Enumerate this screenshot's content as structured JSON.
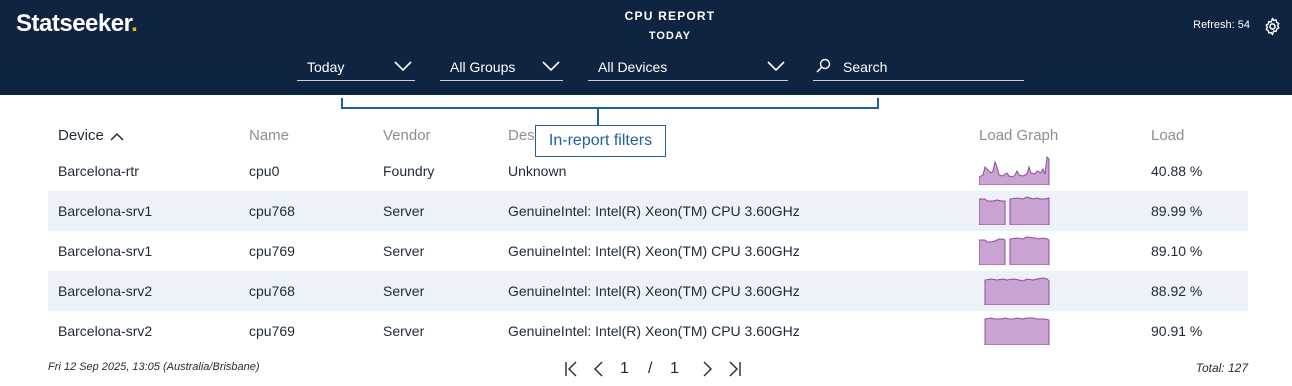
{
  "app": {
    "logo_text": "Statseeker",
    "logo_dot": ".",
    "logo_dot_color": "#f5b400",
    "header_bg": "#0e2441",
    "accent": "#1f5fa8"
  },
  "report": {
    "title": "CPU REPORT",
    "subtitle": "TODAY"
  },
  "refresh": {
    "label": "Refresh: 54"
  },
  "filters": {
    "time": "Today",
    "groups": "All Groups",
    "devices": "All Devices",
    "search_placeholder": "Search"
  },
  "callout": {
    "text": "In-report filters"
  },
  "columns": {
    "device": "Device",
    "name": "Name",
    "vendor": "Vendor",
    "description": "Des",
    "load_graph": "Load Graph",
    "load": "Load"
  },
  "sort": {
    "column": "Device",
    "direction": "ascending",
    "icon": "chevron-up-icon"
  },
  "rows": [
    {
      "device": "Barcelona-rtr",
      "name": "cpu0",
      "vendor": "Foundry",
      "description": "Unknown",
      "load": "40.88 %"
    },
    {
      "device": "Barcelona-srv1",
      "name": "cpu768",
      "vendor": "Server",
      "description": "GenuineIntel: Intel(R) Xeon(TM) CPU 3.60GHz",
      "load": "89.99 %"
    },
    {
      "device": "Barcelona-srv1",
      "name": "cpu769",
      "vendor": "Server",
      "description": "GenuineIntel: Intel(R) Xeon(TM) CPU 3.60GHz",
      "load": "89.10 %"
    },
    {
      "device": "Barcelona-srv2",
      "name": "cpu768",
      "vendor": "Server",
      "description": "GenuineIntel: Intel(R) Xeon(TM) CPU 3.60GHz",
      "load": "88.92 %"
    },
    {
      "device": "Barcelona-srv2",
      "name": "cpu769",
      "vendor": "Server",
      "description": "GenuineIntel: Intel(R) Xeon(TM) CPU 3.60GHz",
      "load": "90.91 %"
    }
  ],
  "graph_color": "#c9a3d2",
  "graph_line_color": "#8e4c9c",
  "footer": {
    "timestamp": "Fri 12 Sep 2025, 13:05 (Australia/Brisbane)",
    "page_current": "1",
    "page_sep": "/",
    "page_total": "1",
    "total": "Total: 127"
  }
}
